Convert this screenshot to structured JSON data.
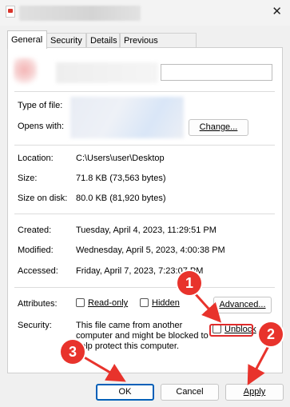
{
  "window": {
    "title_blurred": true,
    "close_glyph": "✕"
  },
  "tabs": [
    "General",
    "Security",
    "Details",
    "Previous Versions"
  ],
  "active_tab": "General",
  "file_info": {
    "type_label": "Type of file:",
    "opens_label": "Opens with:",
    "change_button": "Change..."
  },
  "location": {
    "label": "Location:",
    "value": "C:\\Users\\user\\Desktop"
  },
  "size": {
    "label": "Size:",
    "value": "71.8 KB (73,563 bytes)"
  },
  "size_on_disk": {
    "label": "Size on disk:",
    "value": "80.0 KB (81,920 bytes)"
  },
  "created": {
    "label": "Created:",
    "value": "Tuesday, April 4, 2023, 11:29:51 PM"
  },
  "modified": {
    "label": "Modified:",
    "value": "Wednesday, April 5, 2023, 4:00:38 PM"
  },
  "accessed": {
    "label": "Accessed:",
    "value": "Friday, April 7, 2023, 7:23:07 PM"
  },
  "attributes": {
    "label": "Attributes:",
    "readonly": "Read-only",
    "hidden": "Hidden",
    "advanced_button": "Advanced..."
  },
  "security": {
    "label": "Security:",
    "line1": "This file came from another",
    "line2": "computer and might be blocked to",
    "line3": "help protect this computer.",
    "unblock": "Unblock"
  },
  "buttons": {
    "ok": "OK",
    "cancel": "Cancel",
    "apply": "Apply"
  },
  "annotations": {
    "marker1": "1",
    "marker2": "2",
    "marker3": "3",
    "color": "#e8332c"
  }
}
